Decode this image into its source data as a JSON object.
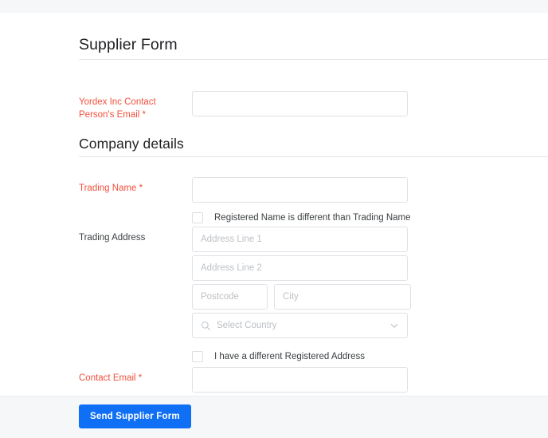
{
  "form": {
    "title": "Supplier Form",
    "section_title": "Company details"
  },
  "fields": {
    "contact_person_email": {
      "label": "Yordex Inc Contact Person's Email *",
      "value": "",
      "placeholder": ""
    },
    "trading_name": {
      "label": "Trading Name *",
      "value": "",
      "placeholder": ""
    },
    "trading_address": {
      "label": "Trading Address",
      "address_line_1": {
        "value": "",
        "placeholder": "Address Line 1"
      },
      "address_line_2": {
        "value": "",
        "placeholder": "Address Line 2"
      },
      "postcode": {
        "value": "",
        "placeholder": "Postcode"
      },
      "city": {
        "value": "",
        "placeholder": "City"
      },
      "country": {
        "value": "",
        "placeholder": "Select Country"
      }
    },
    "contact_email": {
      "label": "Contact Email *",
      "value": "",
      "placeholder": ""
    }
  },
  "checkboxes": {
    "registered_name_different": {
      "label": "Registered Name is different than Trading Name",
      "checked": false
    },
    "different_registered_address": {
      "label": "I have a different Registered Address",
      "checked": false
    }
  },
  "footer": {
    "submit_label": "Send Supplier Form"
  },
  "icons": {
    "search": "search-icon",
    "chevron_down": "chevron-down-icon"
  },
  "colors": {
    "required_label": "#f2503c",
    "primary_button": "#1070f5",
    "page_background": "#ffffff",
    "strip_background": "#f5f7f9",
    "input_border": "#dfe1e5",
    "placeholder_text": "#bdc1c6"
  }
}
